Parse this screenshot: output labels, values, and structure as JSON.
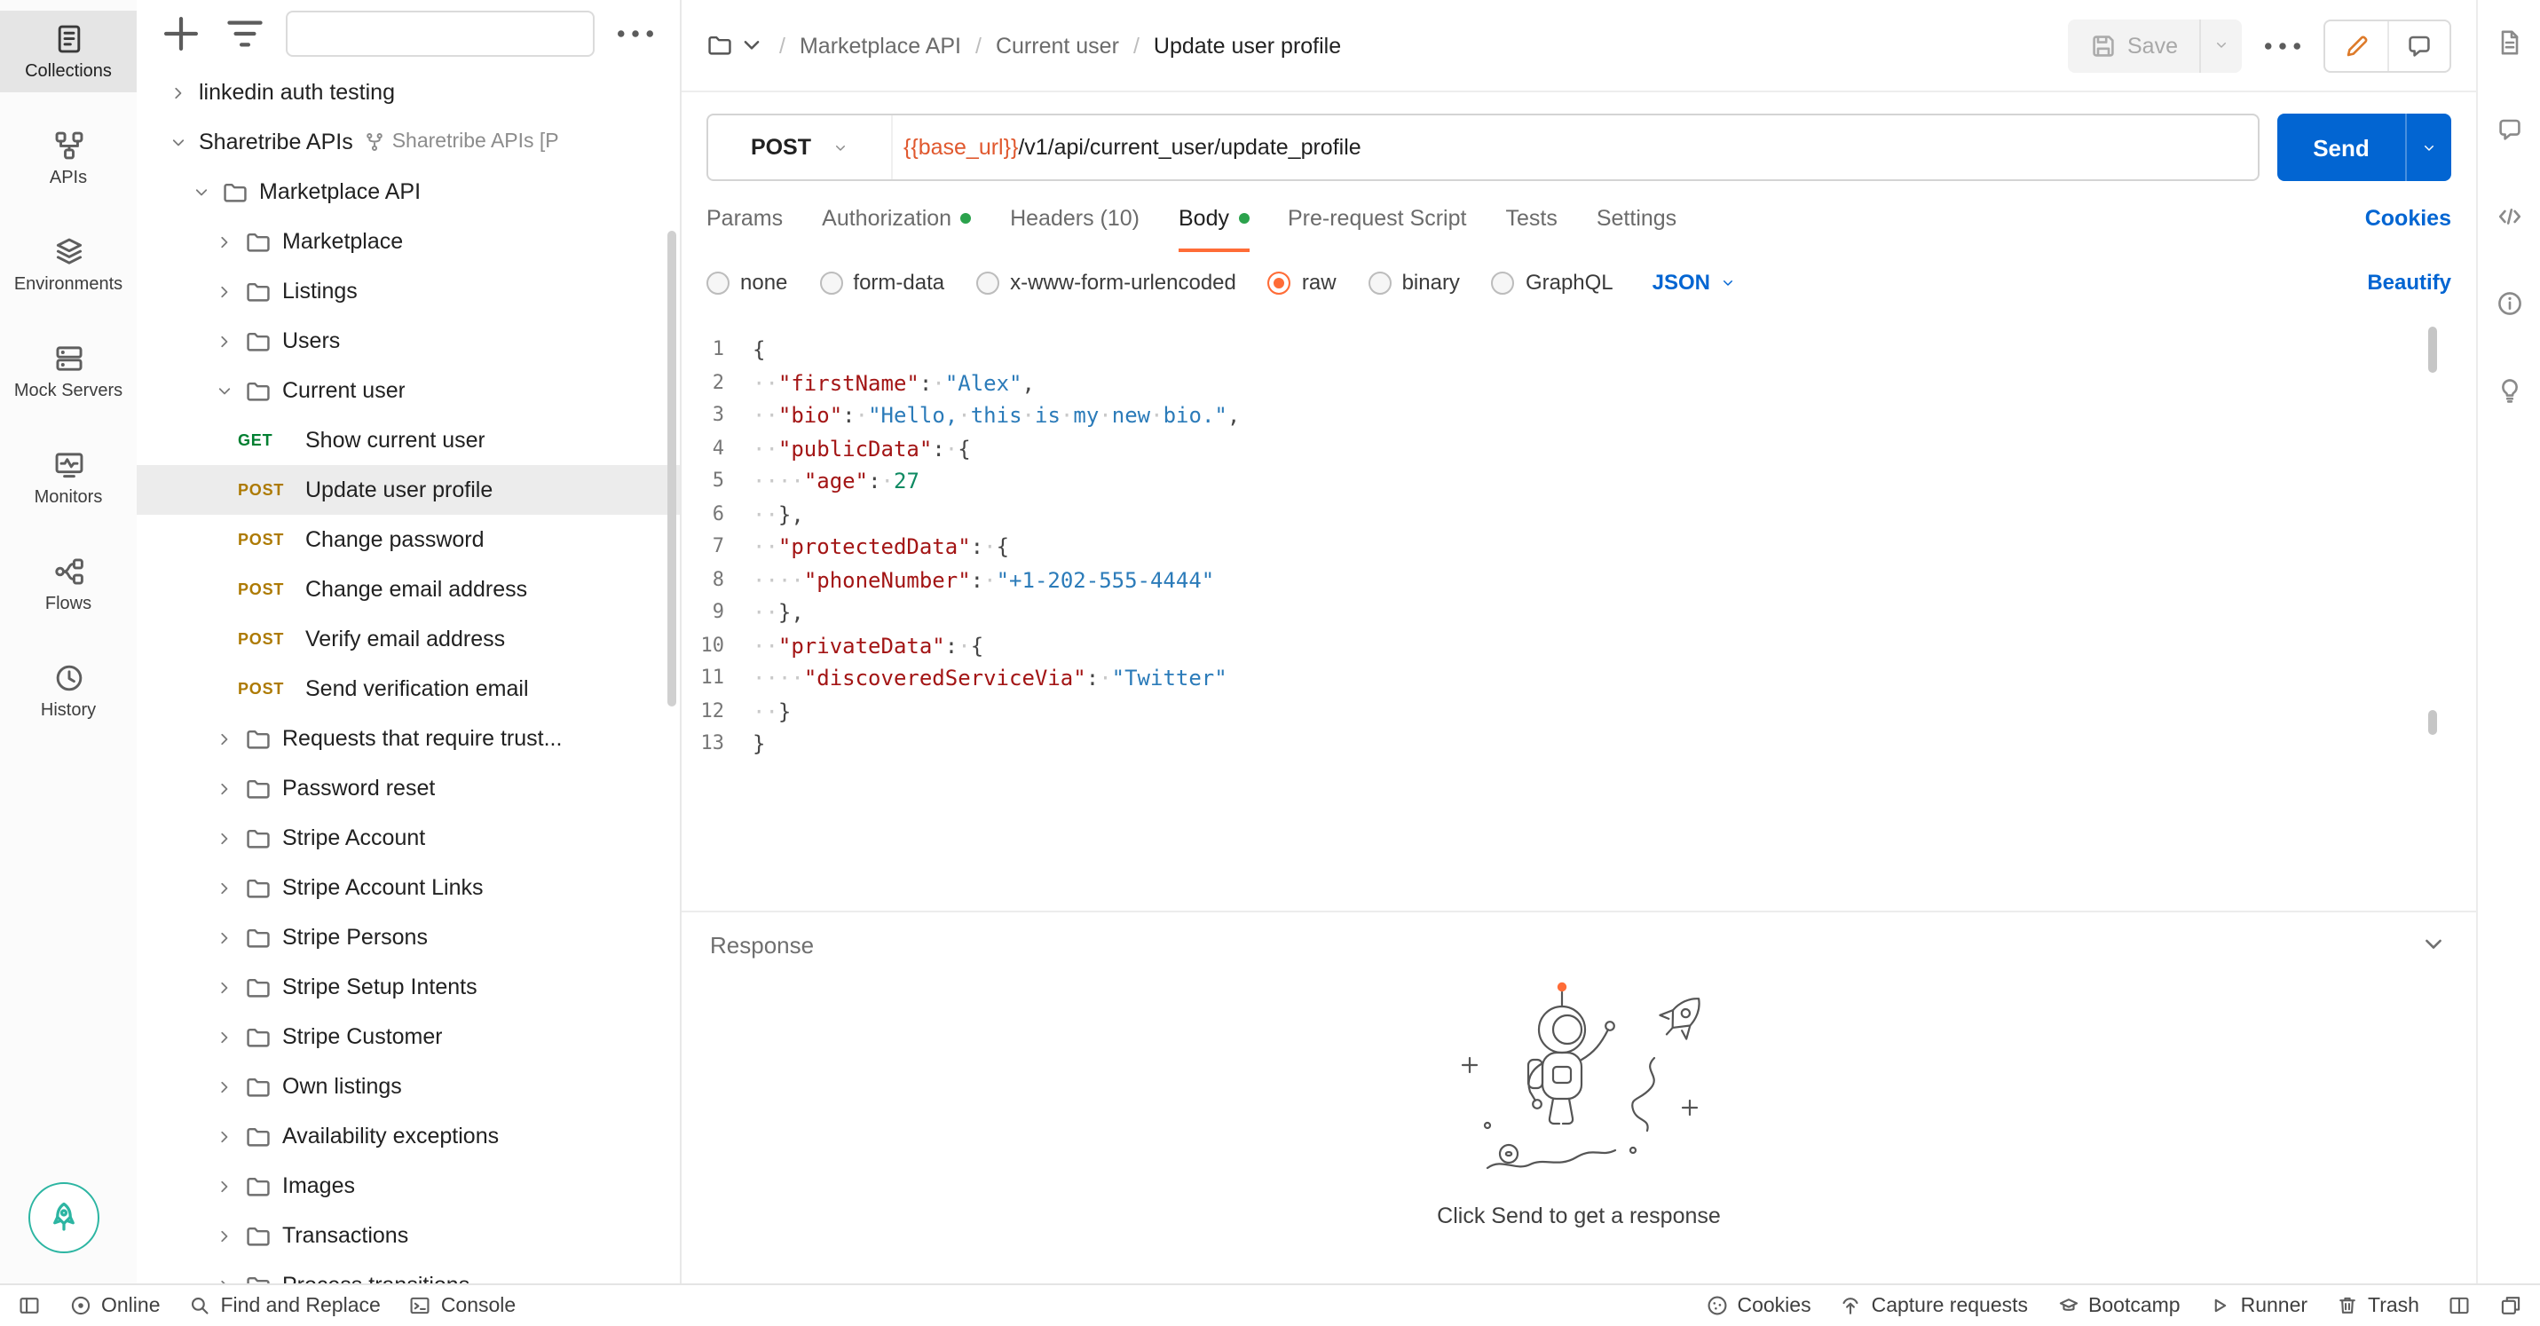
{
  "colors": {
    "accent_orange": "#FF6C37",
    "link_blue": "#0265D2",
    "dot_green": "#2BA24C",
    "get_green": "#007F31",
    "post_orange": "#AD7A03",
    "variable_orange": "#E0582E"
  },
  "left_rail": {
    "items": [
      {
        "label": "Collections",
        "icon": "collections-icon",
        "active": true
      },
      {
        "label": "APIs",
        "icon": "apis-icon",
        "active": false
      },
      {
        "label": "Environments",
        "icon": "environments-icon",
        "active": false
      },
      {
        "label": "Mock Servers",
        "icon": "mock-servers-icon",
        "active": false
      },
      {
        "label": "Monitors",
        "icon": "monitors-icon",
        "active": false
      },
      {
        "label": "Flows",
        "icon": "flows-icon",
        "active": false
      },
      {
        "label": "History",
        "icon": "history-icon",
        "active": false
      }
    ]
  },
  "sidebar": {
    "search_value": "",
    "tree": [
      {
        "level": 0,
        "chevron": "right",
        "label": "linkedin auth testing"
      },
      {
        "level": 0,
        "chevron": "down",
        "label": "Sharetribe APIs",
        "secondary": "Sharetribe APIs [P"
      },
      {
        "level": 1,
        "chevron": "down",
        "folder": true,
        "label": "Marketplace API"
      },
      {
        "level": 2,
        "chevron": "right",
        "folder": true,
        "label": "Marketplace"
      },
      {
        "level": 2,
        "chevron": "right",
        "folder": true,
        "label": "Listings"
      },
      {
        "level": 2,
        "chevron": "right",
        "folder": true,
        "label": "Users"
      },
      {
        "level": 2,
        "chevron": "down",
        "folder": true,
        "label": "Current user"
      },
      {
        "level": 3,
        "method": "GET",
        "label": "Show current user"
      },
      {
        "level": 3,
        "method": "POST",
        "label": "Update user profile",
        "selected": true
      },
      {
        "level": 3,
        "method": "POST",
        "label": "Change password"
      },
      {
        "level": 3,
        "method": "POST",
        "label": "Change email address"
      },
      {
        "level": 3,
        "method": "POST",
        "label": "Verify email address"
      },
      {
        "level": 3,
        "method": "POST",
        "label": "Send verification email"
      },
      {
        "level": 2,
        "chevron": "right",
        "folder": true,
        "label": "Requests that require trust..."
      },
      {
        "level": 2,
        "chevron": "right",
        "folder": true,
        "label": "Password reset"
      },
      {
        "level": 2,
        "chevron": "right",
        "folder": true,
        "label": "Stripe Account"
      },
      {
        "level": 2,
        "chevron": "right",
        "folder": true,
        "label": "Stripe Account Links"
      },
      {
        "level": 2,
        "chevron": "right",
        "folder": true,
        "label": "Stripe Persons"
      },
      {
        "level": 2,
        "chevron": "right",
        "folder": true,
        "label": "Stripe Setup Intents"
      },
      {
        "level": 2,
        "chevron": "right",
        "folder": true,
        "label": "Stripe Customer"
      },
      {
        "level": 2,
        "chevron": "right",
        "folder": true,
        "label": "Own listings"
      },
      {
        "level": 2,
        "chevron": "right",
        "folder": true,
        "label": "Availability exceptions"
      },
      {
        "level": 2,
        "chevron": "right",
        "folder": true,
        "label": "Images"
      },
      {
        "level": 2,
        "chevron": "right",
        "folder": true,
        "label": "Transactions"
      },
      {
        "level": 2,
        "chevron": "right",
        "folder": true,
        "label": "Process transitions"
      }
    ]
  },
  "header": {
    "breadcrumb": [
      "Marketplace API",
      "Current user",
      "Update user profile"
    ],
    "save_label": "Save"
  },
  "request": {
    "method": "POST",
    "url_variable": "{{base_url}}",
    "url_path": "/v1/api/current_user/update_profile",
    "send_label": "Send"
  },
  "tabs": {
    "items": [
      {
        "label": "Params",
        "dot": false,
        "active": false
      },
      {
        "label": "Authorization",
        "dot": true,
        "active": false
      },
      {
        "label": "Headers (10)",
        "dot": false,
        "active": false
      },
      {
        "label": "Body",
        "dot": true,
        "active": true
      },
      {
        "label": "Pre-request Script",
        "dot": false,
        "active": false
      },
      {
        "label": "Tests",
        "dot": false,
        "active": false
      },
      {
        "label": "Settings",
        "dot": false,
        "active": false
      }
    ],
    "cookies_label": "Cookies"
  },
  "body_bar": {
    "options": [
      {
        "label": "none",
        "selected": false
      },
      {
        "label": "form-data",
        "selected": false
      },
      {
        "label": "x-www-form-urlencoded",
        "selected": false
      },
      {
        "label": "raw",
        "selected": true
      },
      {
        "label": "binary",
        "selected": false
      },
      {
        "label": "GraphQL",
        "selected": false
      }
    ],
    "language": "JSON",
    "beautify_label": "Beautify"
  },
  "editor": {
    "lines": [
      "{",
      "  \"firstName\": \"Alex\",",
      "  \"bio\": \"Hello, this is my new bio.\",",
      "  \"publicData\": {",
      "    \"age\": 27",
      "  },",
      "  \"protectedData\": {",
      "    \"phoneNumber\": \"+1-202-555-4444\"",
      "  },",
      "  \"privateData\": {",
      "    \"discoveredServiceVia\": \"Twitter\"",
      "  }",
      "}"
    ]
  },
  "response": {
    "title": "Response",
    "empty_text": "Click Send to get a response"
  },
  "right_rail": {
    "items": [
      {
        "icon": "documentation-icon"
      },
      {
        "icon": "comments-icon"
      },
      {
        "icon": "code-snippet-icon"
      },
      {
        "icon": "info-icon"
      },
      {
        "icon": "lightbulb-icon"
      }
    ]
  },
  "status_bar": {
    "left": [
      {
        "icon": "sidebar-toggle-icon",
        "label": ""
      },
      {
        "icon": "online-status-icon",
        "label": "Online"
      },
      {
        "icon": "find-replace-icon",
        "label": "Find and Replace"
      },
      {
        "icon": "console-icon",
        "label": "Console"
      }
    ],
    "right": [
      {
        "icon": "cookies-icon",
        "label": "Cookies"
      },
      {
        "icon": "capture-icon",
        "label": "Capture requests"
      },
      {
        "icon": "bootcamp-icon",
        "label": "Bootcamp"
      },
      {
        "icon": "runner-icon",
        "label": "Runner"
      },
      {
        "icon": "trash-icon",
        "label": "Trash"
      },
      {
        "icon": "split-pane-icon",
        "label": ""
      },
      {
        "icon": "new-window-icon",
        "label": ""
      }
    ]
  }
}
